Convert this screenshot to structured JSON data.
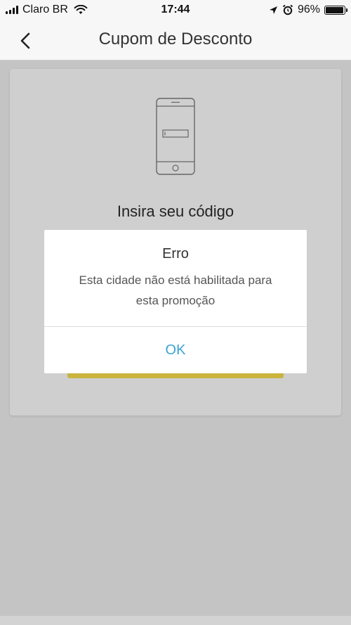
{
  "status_bar": {
    "carrier": "Claro BR",
    "time": "17:44",
    "battery_percent": "96%",
    "battery_level": 0.96
  },
  "nav": {
    "title": "Cupom de Desconto",
    "back_icon": "chevron-left-icon"
  },
  "main": {
    "heading": "Insira seu código",
    "illustration_icon": "phone-code-icon"
  },
  "dialog": {
    "title": "Erro",
    "message_line1": "Esta cidade não está habilitada para",
    "message_line2": "esta promoção",
    "ok_label": "OK"
  },
  "colors": {
    "accent": "#3aa3d6",
    "button_yellow": "#c9b53e",
    "overlay_bg": "#c4c4c4"
  }
}
